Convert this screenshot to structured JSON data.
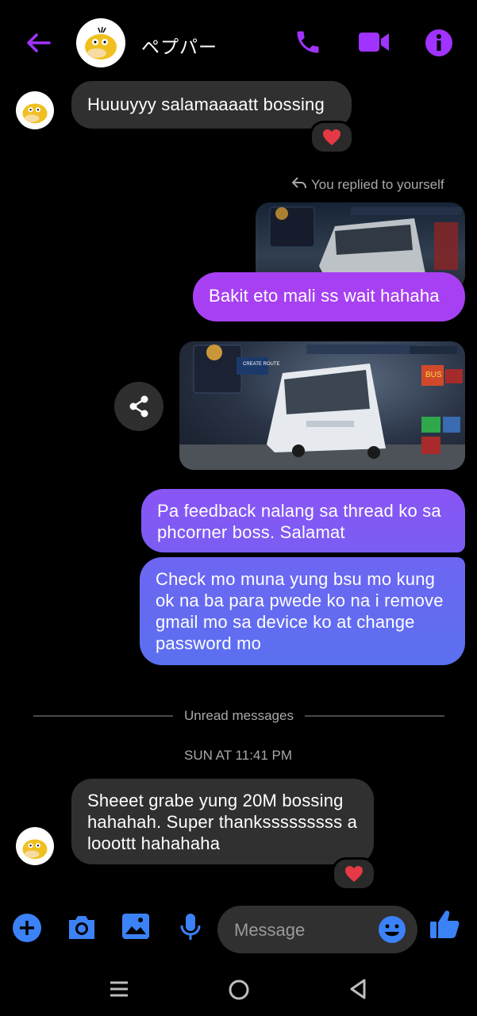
{
  "header": {
    "contact_name": "ペプパー",
    "back_icon": "arrow-left-icon",
    "call_icon": "phone-icon",
    "video_icon": "video-camera-icon",
    "info_icon": "info-icon",
    "accent_color": "#a033ff"
  },
  "messages": [
    {
      "from": "contact",
      "text": "Huuuyyy salamaaaatt bossing",
      "reaction": "heart"
    },
    {
      "reply_label": "You replied to yourself"
    },
    {
      "from": "me",
      "text": "Bakit eto mali ss wait hahaha"
    },
    {
      "from": "me",
      "type": "image"
    },
    {
      "from": "me",
      "text": "Pa feedback nalang sa thread ko sa phcorner boss. Salamat"
    },
    {
      "from": "me",
      "text": "Check mo muna yung bsu mo kung ok na ba para pwede ko na i remove gmail mo sa device ko at change password mo"
    },
    {
      "from": "contact",
      "text": "Sheeet grabe yung 20M bossing hahahah. Super thanksssssssss a looottt hahahaha",
      "reaction": "heart"
    }
  ],
  "divider": {
    "label": "Unread messages"
  },
  "timestamp": "SUN AT 11:41 PM",
  "game_screenshot": {
    "create_route": "CREATE ROUTE",
    "bus_label": "BUS"
  },
  "composer": {
    "placeholder": "Message"
  },
  "colors": {
    "received_bubble": "#303030",
    "sent_gradient_top": "#a33cf0",
    "sent_gradient_bottom": "#5a6cf0",
    "composer_icons": "#3b82f6",
    "reaction_heart": "#e53945"
  }
}
